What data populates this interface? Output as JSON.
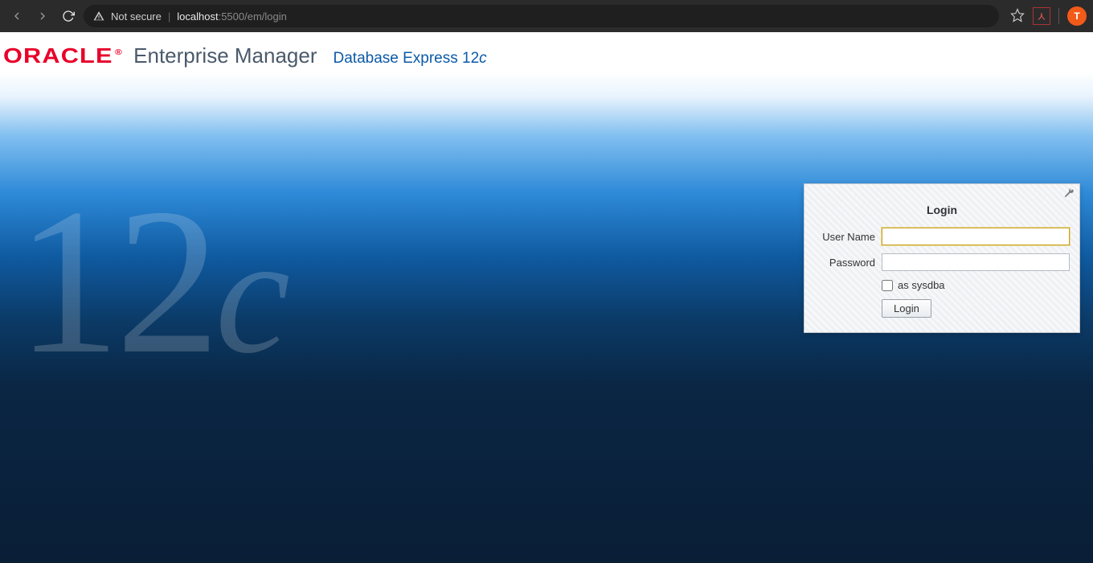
{
  "browser": {
    "not_secure_label": "Not secure",
    "url_host": "localhost",
    "url_rest": ":5500/em/login",
    "avatar_initial": "T"
  },
  "header": {
    "logo_text": "ORACLE",
    "logo_reg": "®",
    "product_title": "Enterprise Manager",
    "product_sub_prefix": "Database Express 12",
    "product_sub_suffix": "c"
  },
  "watermark": {
    "num": "12",
    "suffix": "c"
  },
  "login": {
    "title": "Login",
    "username_label": "User Name",
    "password_label": "Password",
    "sysdba_label": "as sysdba",
    "button_label": "Login",
    "username_value": "",
    "password_value": ""
  }
}
